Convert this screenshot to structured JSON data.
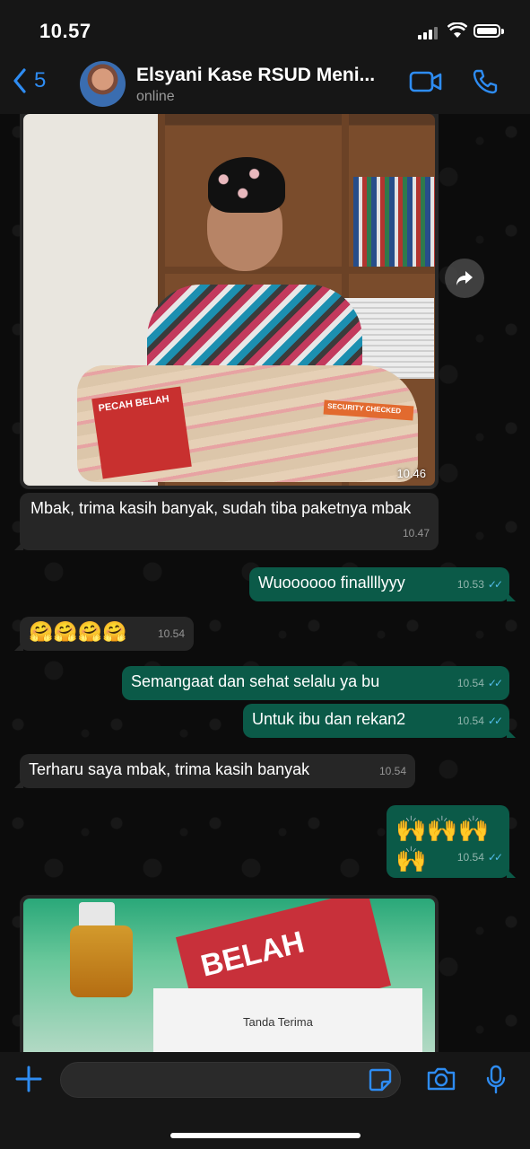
{
  "status_bar": {
    "time": "10.57"
  },
  "header": {
    "back_count": "5",
    "contact_name": "Elsyani Kase RSUD Meni...",
    "contact_status": "online"
  },
  "messages": [
    {
      "type": "image",
      "direction": "in",
      "time": "10.46",
      "labels": [
        "PECAH BELAH",
        "SECURITY CHECKED"
      ]
    },
    {
      "type": "text",
      "direction": "in",
      "text": "Mbak, trima kasih banyak, sudah tiba paketnya mbak",
      "time": "10.47"
    },
    {
      "type": "text",
      "direction": "out",
      "text": "Wuoooooo finallllyyy",
      "time": "10.53",
      "read": true
    },
    {
      "type": "text",
      "direction": "in",
      "text": "🤗🤗🤗🤗",
      "time": "10.54"
    },
    {
      "type": "text",
      "direction": "out",
      "text": "Semangaat dan sehat selalu ya bu",
      "time": "10.54",
      "read": true
    },
    {
      "type": "text",
      "direction": "out",
      "text": "Untuk ibu dan rekan2",
      "time": "10.54",
      "read": true
    },
    {
      "type": "text",
      "direction": "in",
      "text": "Terharu saya mbak, trima kasih banyak",
      "time": "10.54"
    },
    {
      "type": "text",
      "direction": "out",
      "text": "🙌🙌🙌🙌",
      "time": "10.54",
      "read": true
    },
    {
      "type": "image",
      "direction": "in",
      "labels": [
        "BELAH",
        "Tanda Terima"
      ]
    }
  ],
  "colors": {
    "accent": "#2e8cf2",
    "incoming_bubble": "#262626",
    "outgoing_bubble": "#0b5a48",
    "read_ticks": "#53bdeb"
  },
  "icons": {
    "back": "chevron-left-icon",
    "video": "video-camera-icon",
    "call": "phone-icon",
    "forward": "forward-arrow-icon",
    "plus": "plus-icon",
    "sticker": "sticker-icon",
    "camera": "camera-icon",
    "mic": "microphone-icon"
  }
}
